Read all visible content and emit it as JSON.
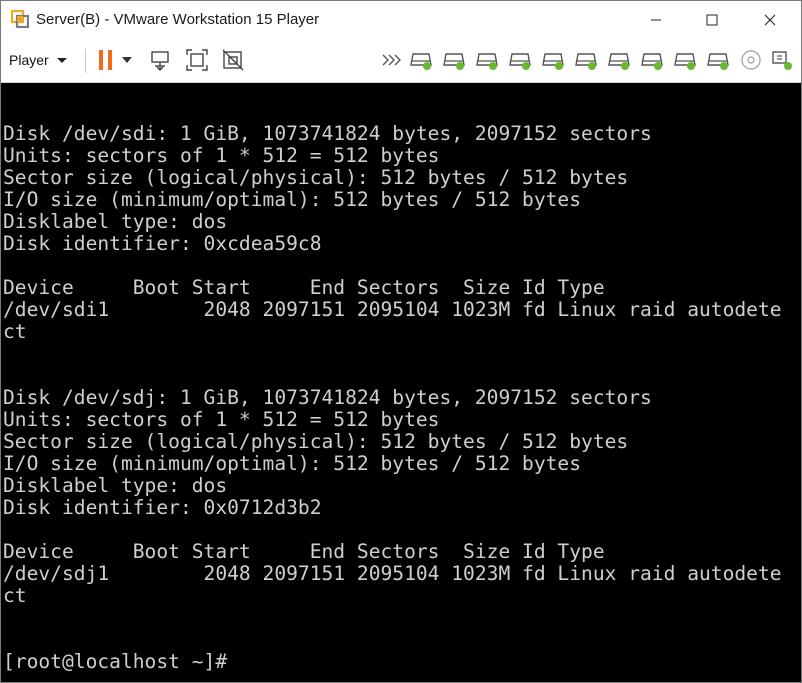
{
  "window": {
    "title": "Server(B) - VMware Workstation 15 Player",
    "icons": [
      "vmware-logo-icon",
      "minimize-icon",
      "maximize-icon",
      "close-icon"
    ]
  },
  "toolbar": {
    "player_label": "Player",
    "accent_color": "#f26b1d",
    "device_status_color": "#6ab82e",
    "icons": [
      "pause-icon",
      "dropdown-icon",
      "send-ctrl-alt-del-icon",
      "fit-guest-icon",
      "unity-icon",
      "expand-devices-icon",
      "hard-disk-icon",
      "cd-dvd-icon",
      "usb-icon"
    ]
  },
  "terminal": {
    "lines": [
      "Disk /dev/sdi: 1 GiB, 1073741824 bytes, 2097152 sectors",
      "Units: sectors of 1 * 512 = 512 bytes",
      "Sector size (logical/physical): 512 bytes / 512 bytes",
      "I/O size (minimum/optimal): 512 bytes / 512 bytes",
      "Disklabel type: dos",
      "Disk identifier: 0xcdea59c8",
      "",
      "Device     Boot Start     End Sectors  Size Id Type",
      "/dev/sdi1        2048 2097151 2095104 1023M fd Linux raid autodete",
      "ct",
      "",
      "",
      "Disk /dev/sdj: 1 GiB, 1073741824 bytes, 2097152 sectors",
      "Units: sectors of 1 * 512 = 512 bytes",
      "Sector size (logical/physical): 512 bytes / 512 bytes",
      "I/O size (minimum/optimal): 512 bytes / 512 bytes",
      "Disklabel type: dos",
      "Disk identifier: 0x0712d3b2",
      "",
      "Device     Boot Start     End Sectors  Size Id Type",
      "/dev/sdj1        2048 2097151 2095104 1023M fd Linux raid autodete",
      "ct",
      "",
      "",
      "[root@localhost ~]#"
    ]
  }
}
